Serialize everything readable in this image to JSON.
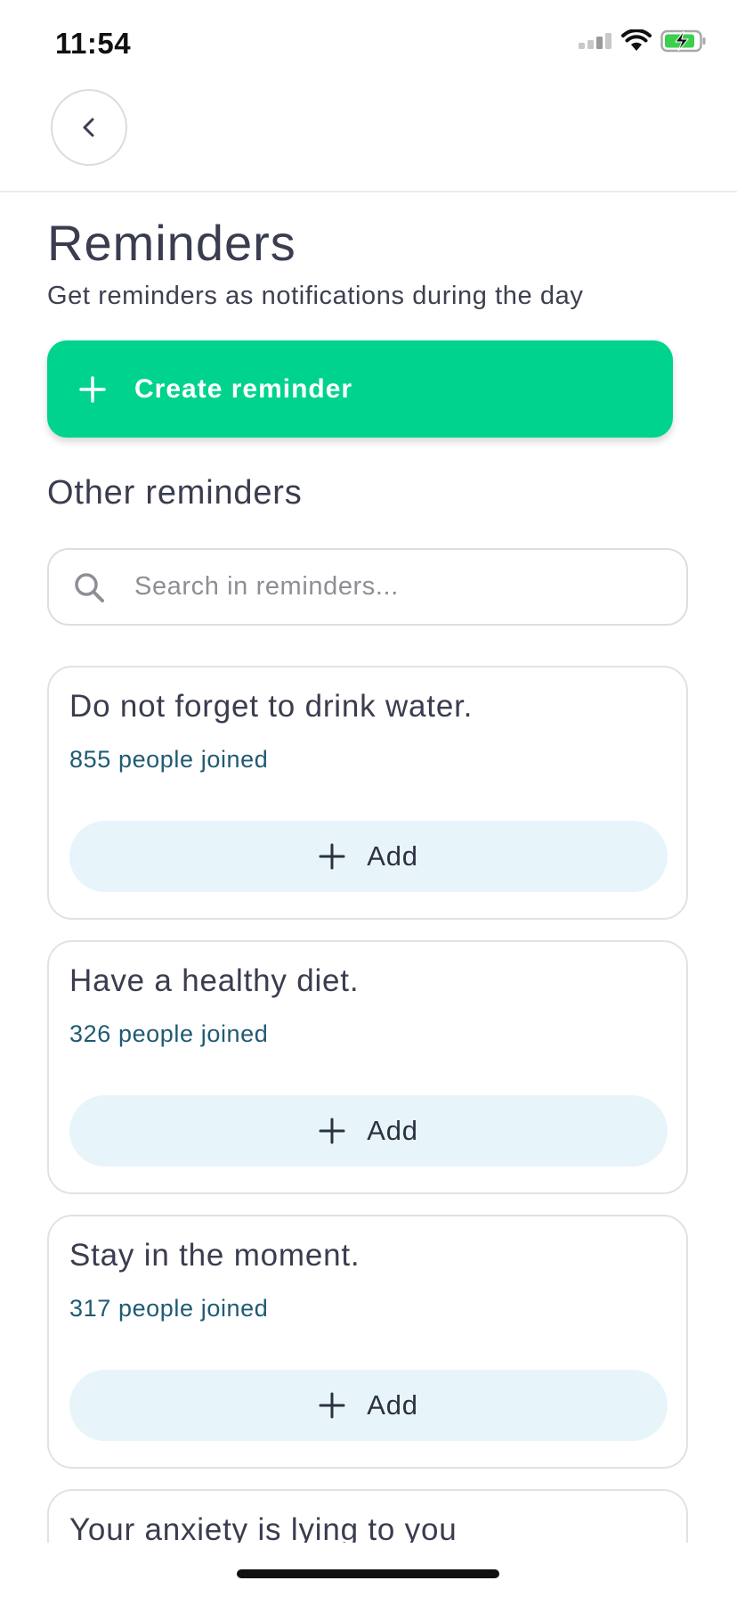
{
  "status_bar": {
    "time": "11:54"
  },
  "page": {
    "title": "Reminders",
    "subtitle": "Get reminders as notifications during the day",
    "create_button_label": "Create reminder",
    "section_title": "Other reminders",
    "search_placeholder": "Search in reminders..."
  },
  "reminders": [
    {
      "title": "Do not forget to drink water.",
      "joined": "855 people joined",
      "add_label": "Add"
    },
    {
      "title": "Have a healthy diet.",
      "joined": "326 people joined",
      "add_label": "Add"
    },
    {
      "title": "Stay in the moment.",
      "joined": "317 people joined",
      "add_label": "Add"
    },
    {
      "title": "Your anxiety is lying to you"
    }
  ],
  "colors": {
    "accent": "#00d38e",
    "joined_text": "#1f5a73",
    "add_button_bg": "#e7f5fa"
  }
}
